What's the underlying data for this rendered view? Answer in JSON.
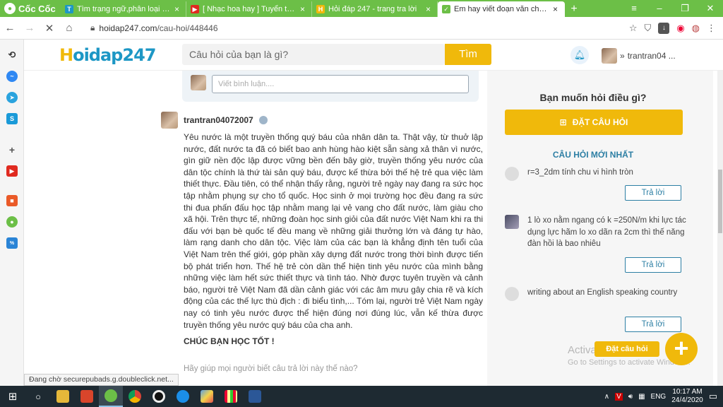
{
  "browser": {
    "name": "Cốc Cốc",
    "tabs": [
      {
        "label": "Tìm trạng ngữ,phân loại các t",
        "icon_color": "#1d97c5",
        "icon_letter": "T"
      },
      {
        "label": "[ Nhạc hoa hay ] Tuyển tập nh",
        "icon_color": "#e02a20",
        "icon_letter": "▶"
      },
      {
        "label": "Hỏi đáp 247 - trang tra lời",
        "icon_color": "#f0b90b",
        "icon_letter": "H"
      },
      {
        "label": "Em hay viết đoạn văn chứng m",
        "icon_color": "#6cbf47",
        "icon_letter": "✓"
      }
    ],
    "new_tab": "+",
    "url_host": "hoidap247.com",
    "url_path": "/cau-hoi/448446"
  },
  "site": {
    "logo_h": "H",
    "logo_rest": "oidap247",
    "search_placeholder": "Câu hỏi của bạn là gì?",
    "search_button": "Tìm",
    "username": "trantran04 ..."
  },
  "comment": {
    "placeholder": "Viết bình luận...."
  },
  "answer": {
    "author": "trantran04072007",
    "body": "Yêu nước là một truyền thống quý báu của nhân dân ta. Thật vậy, từ thuở lập nước, đất nước ta đã có biết bao anh hùng hào kiệt sẵn sàng xả thân vì nước, gìn giữ nền độc lập được vững bền đến bây giờ, truyền thống yêu nước của dân tộc chính là thứ tài sản quý báu, được kế thừa bởi thế hệ trẻ qua việc làm thiết thực. Đầu tiên, có thể nhận thấy rằng, người trẻ ngày nay đang ra sức học tập nhằm phụng sự cho tổ quốc. Học sinh ở mọi trường học đều đang ra sức thi đua phấn đấu học tập nhằm mang lại vẻ vang cho đất nước, làm giàu cho xã hội. Trên thực tế, những đoàn học sinh giỏi của đất nước Việt Nam khi ra thi đấu với bạn bè quốc tế đều mang về những giải thưởng lớn và đáng tự hào, làm rạng danh cho dân tộc. Việc làm của các bạn là khẳng định tên tuổi của Việt Nam trên thế giới, góp phần xây dựng đất nước trong thời bình được tiến bộ phát triển hơn. Thế hệ trẻ còn dần thể hiện tinh yêu nước của mình bằng những việc làm hết sức thiết thực và tình táo. Nhờ được tuyên truyền và cảnh báo, người trẻ Việt Nam đã dần cảnh giác với các âm mưu gây chia rẽ và kích động của các thế lực thù địch : đi biểu tình,... Tóm lại, người trẻ Việt Nam ngày nay có tinh yêu nước được thể hiện đúng nơi đúng lúc, vẫn kế thừa được truyền thống yêu nước quý báu của cha anh.",
    "closing": "CHÚC BẠN HỌC TỐT !",
    "help_prompt": "Hãy giúp mọi người biết câu trả lời này thế nào?"
  },
  "sidebar": {
    "ask_heading": "Bạn muốn hỏi điều gì?",
    "ask_button": "ĐẶT CÂU HỎI",
    "newest_heading": "CÂU HỎI MỚI NHẤT",
    "questions": [
      {
        "text": "r=3_2dm tính chu vi hình tròn",
        "reply": "Trả lời"
      },
      {
        "text": "1 lò xo nằm ngang có k =250N/m khi lực tác dụng lực hãm lo xo dãn ra 2cm thì thế năng đàn hồi là bao nhiêu",
        "reply": "Trả lời"
      },
      {
        "text": "writing about an English speaking country",
        "reply": "Trả lời"
      }
    ]
  },
  "floating": {
    "label": "Đặt câu hỏi",
    "plus": "+"
  },
  "windows": {
    "activate_title": "Activate Windows",
    "activate_sub": "Go to Settings to activate Windows.",
    "lang": "ENG",
    "time": "10:17 AM",
    "date": "24/4/2020"
  },
  "status": "Đang chờ securepubads.g.doubleclick.net...",
  "colors": {
    "brand_yellow": "#f0b90b",
    "brand_blue": "#1d97c5",
    "browser_green": "#6cbf47"
  }
}
